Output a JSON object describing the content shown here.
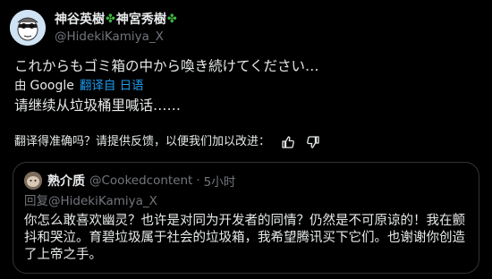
{
  "author": {
    "name_part1": "神谷英樹",
    "name_part2": "神宮秀樹",
    "handle": "@HidekiKamiya_X",
    "badge_icon": "clover-icon",
    "badge_color": "#3fb83f"
  },
  "post": {
    "original_text": "これからもゴミ箱の中から喚き続けてください…",
    "translated_by_prefix": "由",
    "translated_by_brand": "Google",
    "translated_from": "翻译自 日语",
    "translation_text": "请继续从垃圾桶里喊话……"
  },
  "feedback": {
    "prompt": "翻译得准确吗？请提供反馈，以便我们加以改进：",
    "thumbs_up_icon": "thumbs-up-icon",
    "thumbs_down_icon": "thumbs-down-icon"
  },
  "quote": {
    "name": "熟介质",
    "handle": "@Cookedcontent",
    "separator": "·",
    "time": "5小时",
    "reply_prefix": "回复",
    "reply_to": "@HidekiKamiya_X",
    "body": "你怎么敢喜欢幽灵？也许是对同为开发者的同情？仍然是不可原谅的！我在颤抖和哭泣。育碧垃圾属于社会的垃圾箱，我希望腾讯买下它们。也谢谢你创造了上帝之手。"
  },
  "colors": {
    "background": "#000000",
    "text": "#e7e9ea",
    "muted": "#71767b",
    "link": "#1d9bf0",
    "border": "#2f3336"
  }
}
